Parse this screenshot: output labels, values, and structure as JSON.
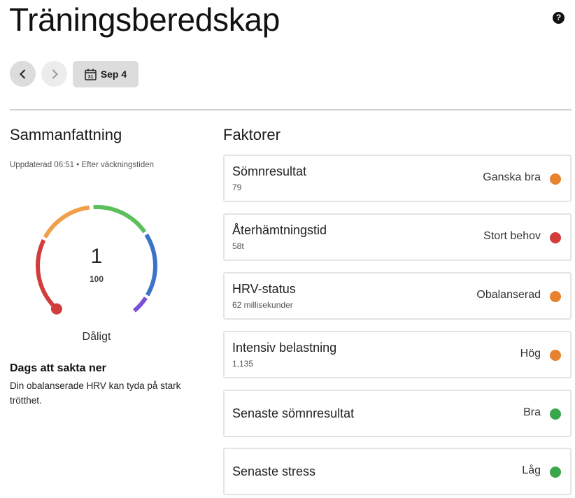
{
  "header": {
    "title": "Träningsberedskap",
    "help_icon": "?",
    "date_label": "Sep 4",
    "calendar_day": "31"
  },
  "summary": {
    "title": "Sammanfattning",
    "updated": "Uppdaterad 06:51 • Efter väckningstiden",
    "score": "1",
    "score_max": "100",
    "level": "Dåligt",
    "message_title": "Dags att sakta ner",
    "message_body": "Din obalanserade HRV kan tyda på stark trötthet."
  },
  "gauge": {
    "value": 1,
    "max": 100,
    "segment_colors": [
      "#d23c3c",
      "#f0a04b",
      "#5bbf5b",
      "#3a73c9",
      "#7b4fd8"
    ]
  },
  "factors": {
    "title": "Faktorer",
    "items": [
      {
        "name": "Sömnresultat",
        "value": "79",
        "status": "Ganska bra",
        "color": "#e8822f"
      },
      {
        "name": "Återhämtningstid",
        "value": "58t",
        "status": "Stort behov",
        "color": "#d23c3c"
      },
      {
        "name": "HRV-status",
        "value": "62 millisekunder",
        "status": "Obalanserad",
        "color": "#e8822f"
      },
      {
        "name": "Intensiv belastning",
        "value": "1,135",
        "status": "Hög",
        "color": "#e8822f"
      },
      {
        "name": "Senaste sömnresultat",
        "value": "",
        "status": "Bra",
        "color": "#3aa64c"
      },
      {
        "name": "Senaste stress",
        "value": "",
        "status": "Låg",
        "color": "#3aa64c"
      }
    ]
  }
}
